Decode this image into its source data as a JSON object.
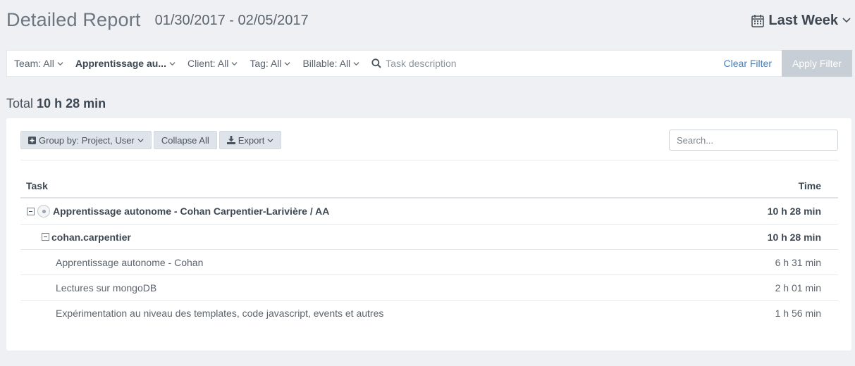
{
  "header": {
    "title": "Detailed Report",
    "date_range": "01/30/2017 - 02/05/2017",
    "range_label": "Last Week"
  },
  "filters": {
    "team": "Team: All",
    "project": "Apprentissage au...",
    "client": "Client: All",
    "tag": "Tag: All",
    "billable": "Billable: All",
    "task_placeholder": "Task description",
    "clear_label": "Clear Filter",
    "apply_label": "Apply Filter"
  },
  "total": {
    "label": "Total",
    "value": "10 h 28 min"
  },
  "toolbar": {
    "group_by": "Group by: Project, User",
    "collapse_all": "Collapse All",
    "export": "Export",
    "search_placeholder": "Search..."
  },
  "table": {
    "col_task": "Task",
    "col_time": "Time",
    "project": {
      "name": "Apprentissage autonome - Cohan Carpentier-Larivière  /  AA",
      "time": "10 h 28 min"
    },
    "user": {
      "name": "cohan.carpentier",
      "time": "10 h 28 min"
    },
    "tasks": [
      {
        "name": "Apprentissage autonome - Cohan",
        "time": "6 h 31 min"
      },
      {
        "name": "Lectures sur mongoDB",
        "time": "2 h 01 min"
      },
      {
        "name": "Expérimentation au niveau des templates, code javascript, events et autres",
        "time": "1 h 56 min"
      }
    ]
  }
}
